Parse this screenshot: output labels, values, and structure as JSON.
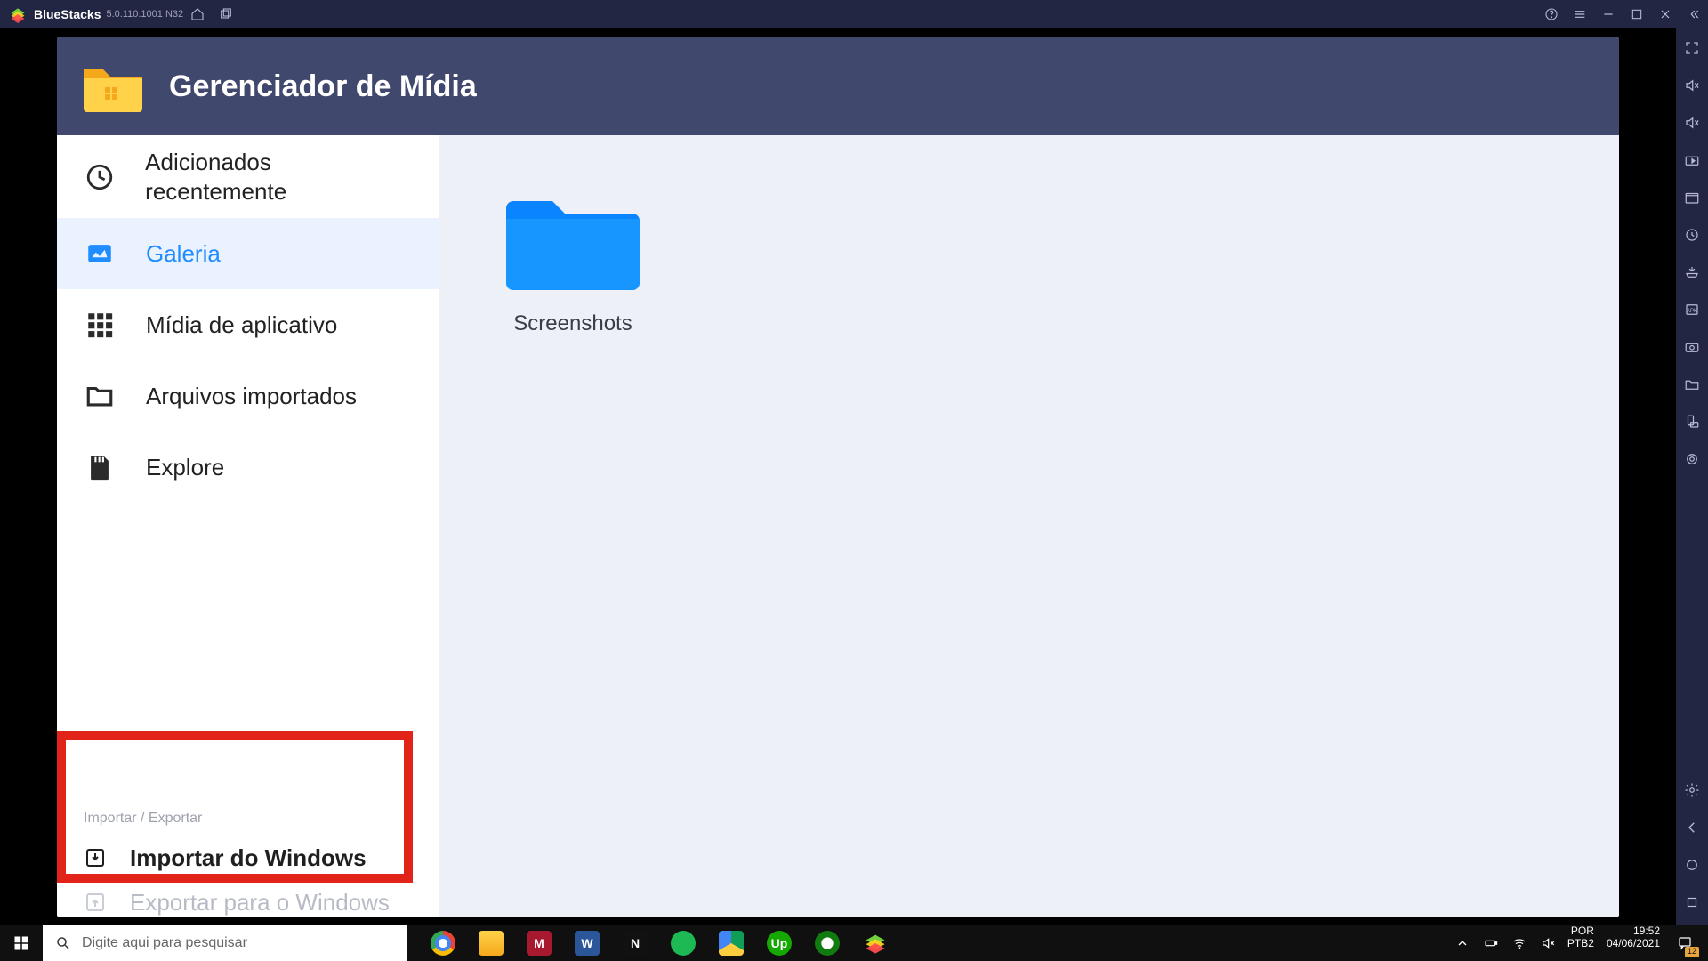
{
  "titlebar": {
    "app_name": "BlueStacks",
    "version": "5.0.110.1001 N32"
  },
  "media_manager": {
    "title": "Gerenciador de Mídia",
    "sidebar": {
      "recent": "Adicionados recentemente",
      "gallery": "Galeria",
      "app_media": "Mídia de aplicativo",
      "imported": "Arquivos importados",
      "explore": "Explore",
      "section_label": "Importar / Exportar",
      "import_windows": "Importar do Windows",
      "export_windows": "Exportar para o Windows"
    },
    "content": {
      "folder_name": "Screenshots"
    }
  },
  "taskbar": {
    "search_placeholder": "Digite aqui para pesquisar",
    "lang_top": "POR",
    "lang_bottom": "PTB2",
    "time": "19:52",
    "date": "04/06/2021",
    "notification_count": "12"
  }
}
